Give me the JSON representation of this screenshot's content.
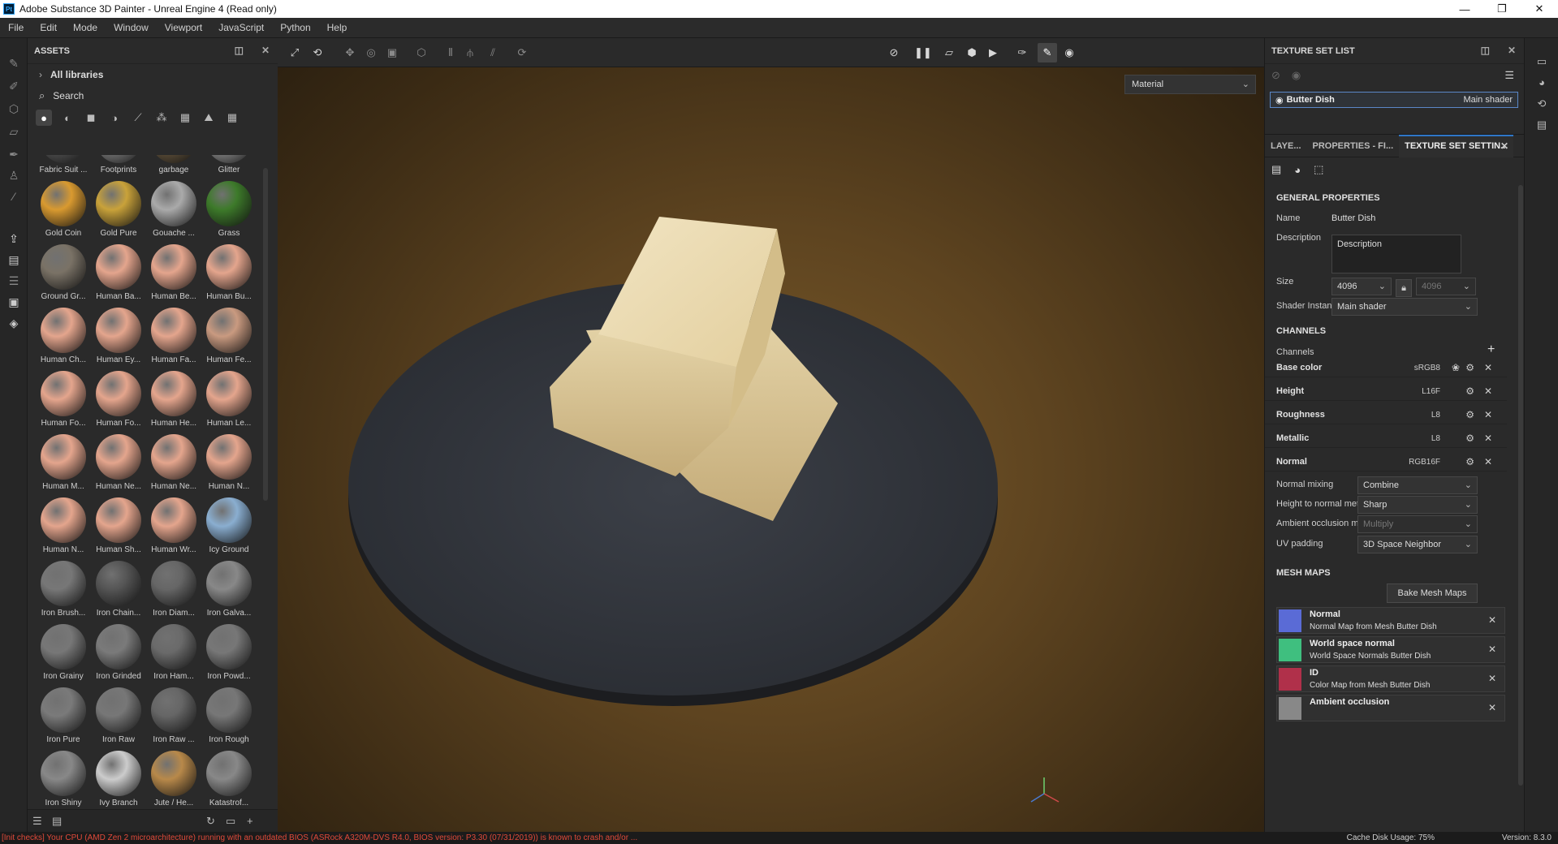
{
  "window": {
    "title": "Adobe Substance 3D Painter - Unreal Engine 4 (Read only)",
    "app_icon": "Pt",
    "controls": {
      "minimize": "—",
      "restore": "❐",
      "close": "✕"
    }
  },
  "menu": [
    "File",
    "Edit",
    "Mode",
    "Window",
    "Viewport",
    "JavaScript",
    "Python",
    "Help"
  ],
  "assets": {
    "title": "ASSETS",
    "libraries": "All libraries",
    "search_placeholder": "Search",
    "items": [
      {
        "label": "Fabric Suit ...",
        "color": "#5a5a5a"
      },
      {
        "label": "Footprints",
        "color": "#888"
      },
      {
        "label": "garbage",
        "color": "#6b5a40"
      },
      {
        "label": "Glitter",
        "color": "#999"
      },
      {
        "label": "Gold Coin",
        "color": "#d99a30"
      },
      {
        "label": "Gold Pure",
        "color": "#c9a23a"
      },
      {
        "label": "Gouache ...",
        "color": "#aaa"
      },
      {
        "label": "Grass",
        "color": "#3d7a2a"
      },
      {
        "label": "Ground Gr...",
        "color": "#7a7266"
      },
      {
        "label": "Human Ba...",
        "color": "#e4a58d"
      },
      {
        "label": "Human Be...",
        "color": "#e4a58d"
      },
      {
        "label": "Human Bu...",
        "color": "#e4a58d"
      },
      {
        "label": "Human Ch...",
        "color": "#e4a58d"
      },
      {
        "label": "Human Ey...",
        "color": "#e4a58d"
      },
      {
        "label": "Human Fa...",
        "color": "#e4a58d"
      },
      {
        "label": "Human Fe...",
        "color": "#c99a80"
      },
      {
        "label": "Human Fo...",
        "color": "#e4a58d"
      },
      {
        "label": "Human Fo...",
        "color": "#e4a58d"
      },
      {
        "label": "Human He...",
        "color": "#e4a58d"
      },
      {
        "label": "Human Le...",
        "color": "#e4a58d"
      },
      {
        "label": "Human M...",
        "color": "#e4a58d"
      },
      {
        "label": "Human Ne...",
        "color": "#e4a58d"
      },
      {
        "label": "Human Ne...",
        "color": "#e4a58d"
      },
      {
        "label": "Human N...",
        "color": "#e4a58d"
      },
      {
        "label": "Human N...",
        "color": "#e4a58d"
      },
      {
        "label": "Human Sh...",
        "color": "#e4a58d"
      },
      {
        "label": "Human Wr...",
        "color": "#e4a58d"
      },
      {
        "label": "Icy Ground",
        "color": "#8aaed0"
      },
      {
        "label": "Iron Brush...",
        "color": "#777"
      },
      {
        "label": "Iron Chain...",
        "color": "#555"
      },
      {
        "label": "Iron Diam...",
        "color": "#666"
      },
      {
        "label": "Iron Galva...",
        "color": "#888"
      },
      {
        "label": "Iron Grainy",
        "color": "#777"
      },
      {
        "label": "Iron Grinded",
        "color": "#7a7a7a"
      },
      {
        "label": "Iron Ham...",
        "color": "#6a6a6a"
      },
      {
        "label": "Iron Powd...",
        "color": "#777"
      },
      {
        "label": "Iron Pure",
        "color": "#7a7a7a"
      },
      {
        "label": "Iron Raw",
        "color": "#777"
      },
      {
        "label": "Iron Raw ...",
        "color": "#666"
      },
      {
        "label": "Iron Rough",
        "color": "#777"
      },
      {
        "label": "Iron Shiny",
        "color": "#888"
      },
      {
        "label": "Ivy Branch",
        "color": "#ccc"
      },
      {
        "label": "Jute / He...",
        "color": "#b8894a"
      },
      {
        "label": "Katastrof...",
        "color": "#888"
      }
    ]
  },
  "viewport": {
    "mode": "Material"
  },
  "texture_set_list": {
    "title": "TEXTURE SET LIST",
    "set_name": "Butter Dish",
    "shader": "Main shader"
  },
  "props": {
    "tabs": [
      "LAYE...",
      "PROPERTIES - FI...",
      "TEXTURE SET SETTIN..."
    ],
    "general_title": "GENERAL PROPERTIES",
    "name_label": "Name",
    "name_value": "Butter Dish",
    "desc_label": "Description",
    "desc_value": "Description",
    "size_label": "Size",
    "size_value": "4096",
    "size_value2": "4096",
    "shader_label": "Shader Instance",
    "shader_value": "Main shader",
    "channels_title": "CHANNELS",
    "channels_label": "Channels",
    "channels": [
      {
        "name": "Base color",
        "fmt": "sRGB8"
      },
      {
        "name": "Height",
        "fmt": "L16F"
      },
      {
        "name": "Roughness",
        "fmt": "L8"
      },
      {
        "name": "Metallic",
        "fmt": "L8"
      },
      {
        "name": "Normal",
        "fmt": "RGB16F"
      }
    ],
    "nm_label": "Normal mixing",
    "nm_value": "Combine",
    "h2n_label": "Height to normal method",
    "h2n_value": "Sharp",
    "ao_label": "Ambient occlusion mixing",
    "ao_value": "Multiply",
    "uv_label": "UV padding",
    "uv_value": "3D Space Neighbor",
    "mesh_title": "MESH MAPS",
    "bake_label": "Bake Mesh Maps",
    "meshmaps": [
      {
        "title": "Normal",
        "sub": "Normal Map from Mesh Butter Dish"
      },
      {
        "title": "World space normal",
        "sub": "World Space Normals Butter Dish"
      },
      {
        "title": "ID",
        "sub": "Color Map from Mesh Butter Dish"
      },
      {
        "title": "Ambient occlusion",
        "sub": ""
      }
    ]
  },
  "status": {
    "error": "[Init checks] Your CPU (AMD Zen 2 microarchitecture) running with an outdated BIOS (ASRock A320M-DVS R4.0, BIOS version: P3.30 (07/31/2019)) is known to crash and/or ...",
    "cache": "Cache Disk Usage:  75%",
    "version": "Version: 8.3.0"
  }
}
